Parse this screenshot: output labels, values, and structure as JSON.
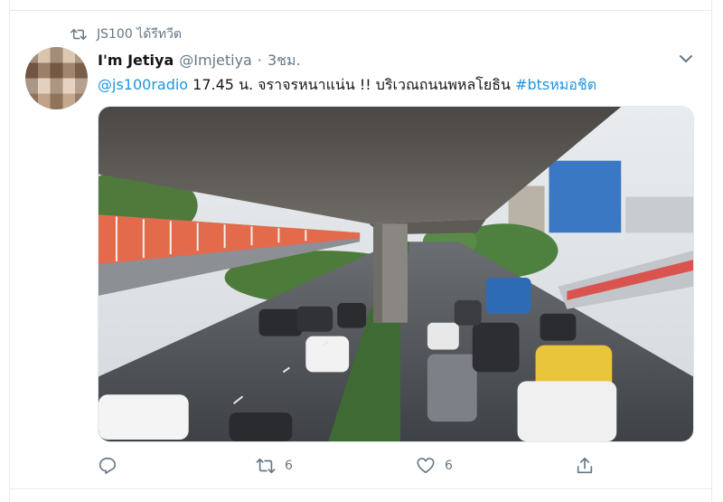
{
  "retweet_context": {
    "icon": "retweet-icon",
    "text": "JS100 ได้รีทวีต"
  },
  "tweet": {
    "display_name": "I'm Jetiya",
    "handle": "@Imjetiya",
    "separator": "·",
    "time": "3ชม.",
    "text": {
      "mention": "@js100radio",
      "body": " 17.45 น. จราจรหนาแน่น  !! บริเวณถนนพหลโยธิน ",
      "hashtag": "#btsหมอชิต"
    },
    "media": {
      "description_icon": "traffic-photo"
    },
    "actions": {
      "reply": {
        "icon": "reply-icon",
        "count": ""
      },
      "retweet": {
        "icon": "retweet-icon",
        "count": "6"
      },
      "like": {
        "icon": "heart-icon",
        "count": "6"
      },
      "share": {
        "icon": "share-icon",
        "count": ""
      }
    }
  },
  "colors": {
    "link": "#1b95e0",
    "muted": "#657786",
    "text": "#14171a",
    "border": "#e6ecf0"
  }
}
